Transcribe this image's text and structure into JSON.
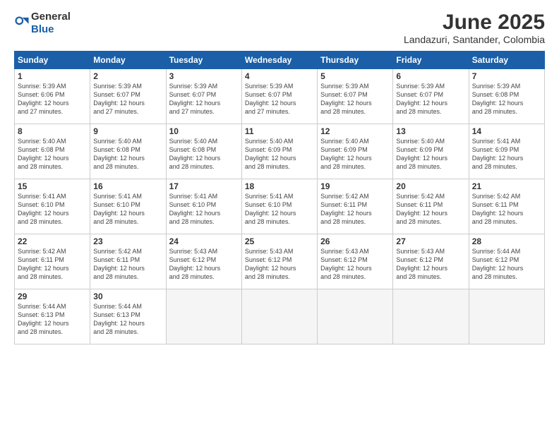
{
  "app": {
    "logo_general": "General",
    "logo_blue": "Blue"
  },
  "header": {
    "month": "June 2025",
    "location": "Landazuri, Santander, Colombia"
  },
  "weekdays": [
    "Sunday",
    "Monday",
    "Tuesday",
    "Wednesday",
    "Thursday",
    "Friday",
    "Saturday"
  ],
  "weeks": [
    [
      {
        "day": "1",
        "info": "Sunrise: 5:39 AM\nSunset: 6:06 PM\nDaylight: 12 hours\nand 27 minutes."
      },
      {
        "day": "2",
        "info": "Sunrise: 5:39 AM\nSunset: 6:07 PM\nDaylight: 12 hours\nand 27 minutes."
      },
      {
        "day": "3",
        "info": "Sunrise: 5:39 AM\nSunset: 6:07 PM\nDaylight: 12 hours\nand 27 minutes."
      },
      {
        "day": "4",
        "info": "Sunrise: 5:39 AM\nSunset: 6:07 PM\nDaylight: 12 hours\nand 27 minutes."
      },
      {
        "day": "5",
        "info": "Sunrise: 5:39 AM\nSunset: 6:07 PM\nDaylight: 12 hours\nand 28 minutes."
      },
      {
        "day": "6",
        "info": "Sunrise: 5:39 AM\nSunset: 6:07 PM\nDaylight: 12 hours\nand 28 minutes."
      },
      {
        "day": "7",
        "info": "Sunrise: 5:39 AM\nSunset: 6:08 PM\nDaylight: 12 hours\nand 28 minutes."
      }
    ],
    [
      {
        "day": "8",
        "info": "Sunrise: 5:40 AM\nSunset: 6:08 PM\nDaylight: 12 hours\nand 28 minutes."
      },
      {
        "day": "9",
        "info": "Sunrise: 5:40 AM\nSunset: 6:08 PM\nDaylight: 12 hours\nand 28 minutes."
      },
      {
        "day": "10",
        "info": "Sunrise: 5:40 AM\nSunset: 6:08 PM\nDaylight: 12 hours\nand 28 minutes."
      },
      {
        "day": "11",
        "info": "Sunrise: 5:40 AM\nSunset: 6:09 PM\nDaylight: 12 hours\nand 28 minutes."
      },
      {
        "day": "12",
        "info": "Sunrise: 5:40 AM\nSunset: 6:09 PM\nDaylight: 12 hours\nand 28 minutes."
      },
      {
        "day": "13",
        "info": "Sunrise: 5:40 AM\nSunset: 6:09 PM\nDaylight: 12 hours\nand 28 minutes."
      },
      {
        "day": "14",
        "info": "Sunrise: 5:41 AM\nSunset: 6:09 PM\nDaylight: 12 hours\nand 28 minutes."
      }
    ],
    [
      {
        "day": "15",
        "info": "Sunrise: 5:41 AM\nSunset: 6:10 PM\nDaylight: 12 hours\nand 28 minutes."
      },
      {
        "day": "16",
        "info": "Sunrise: 5:41 AM\nSunset: 6:10 PM\nDaylight: 12 hours\nand 28 minutes."
      },
      {
        "day": "17",
        "info": "Sunrise: 5:41 AM\nSunset: 6:10 PM\nDaylight: 12 hours\nand 28 minutes."
      },
      {
        "day": "18",
        "info": "Sunrise: 5:41 AM\nSunset: 6:10 PM\nDaylight: 12 hours\nand 28 minutes."
      },
      {
        "day": "19",
        "info": "Sunrise: 5:42 AM\nSunset: 6:11 PM\nDaylight: 12 hours\nand 28 minutes."
      },
      {
        "day": "20",
        "info": "Sunrise: 5:42 AM\nSunset: 6:11 PM\nDaylight: 12 hours\nand 28 minutes."
      },
      {
        "day": "21",
        "info": "Sunrise: 5:42 AM\nSunset: 6:11 PM\nDaylight: 12 hours\nand 28 minutes."
      }
    ],
    [
      {
        "day": "22",
        "info": "Sunrise: 5:42 AM\nSunset: 6:11 PM\nDaylight: 12 hours\nand 28 minutes."
      },
      {
        "day": "23",
        "info": "Sunrise: 5:42 AM\nSunset: 6:11 PM\nDaylight: 12 hours\nand 28 minutes."
      },
      {
        "day": "24",
        "info": "Sunrise: 5:43 AM\nSunset: 6:12 PM\nDaylight: 12 hours\nand 28 minutes."
      },
      {
        "day": "25",
        "info": "Sunrise: 5:43 AM\nSunset: 6:12 PM\nDaylight: 12 hours\nand 28 minutes."
      },
      {
        "day": "26",
        "info": "Sunrise: 5:43 AM\nSunset: 6:12 PM\nDaylight: 12 hours\nand 28 minutes."
      },
      {
        "day": "27",
        "info": "Sunrise: 5:43 AM\nSunset: 6:12 PM\nDaylight: 12 hours\nand 28 minutes."
      },
      {
        "day": "28",
        "info": "Sunrise: 5:44 AM\nSunset: 6:12 PM\nDaylight: 12 hours\nand 28 minutes."
      }
    ],
    [
      {
        "day": "29",
        "info": "Sunrise: 5:44 AM\nSunset: 6:13 PM\nDaylight: 12 hours\nand 28 minutes."
      },
      {
        "day": "30",
        "info": "Sunrise: 5:44 AM\nSunset: 6:13 PM\nDaylight: 12 hours\nand 28 minutes."
      },
      {
        "day": "",
        "info": ""
      },
      {
        "day": "",
        "info": ""
      },
      {
        "day": "",
        "info": ""
      },
      {
        "day": "",
        "info": ""
      },
      {
        "day": "",
        "info": ""
      }
    ]
  ]
}
